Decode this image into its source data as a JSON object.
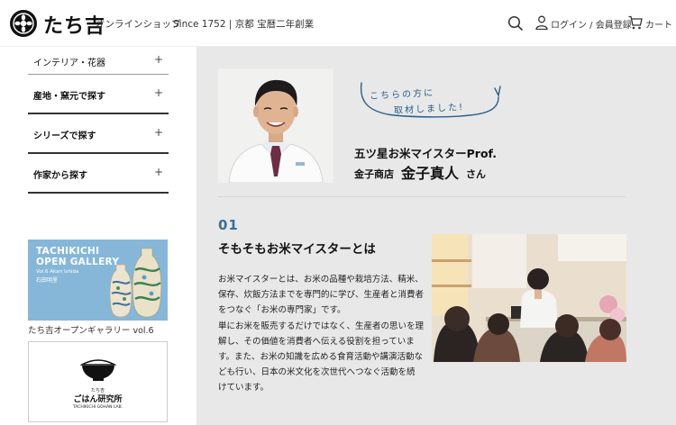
{
  "header": {
    "logo_text": "たち吉",
    "shop_label": "オンラインショップ",
    "since_label": "Since 1752 | 京都 宝暦二年創業",
    "login_label": "ログイン / 会員登録",
    "cart_label": "カート"
  },
  "sidebar": {
    "categories": [
      {
        "label": "インテリア・花器",
        "toggle": "+"
      },
      {
        "label": "産地・窯元で探す",
        "toggle": "+"
      },
      {
        "label": "シリーズで探す",
        "toggle": "+"
      },
      {
        "label": "作家から探す",
        "toggle": "+"
      }
    ],
    "gallery_banner": {
      "title_line1": "TACHIKICHI",
      "title_line2": "OPEN GALLERY",
      "vol": "Vol.6  Akari Ishida",
      "artist": "石田明里",
      "caption": "たち吉オープンギャラリー vol.6"
    },
    "gohan_banner": {
      "small": "たち吉",
      "title": "ごはん研究所",
      "en": "TACHIKICHI GOHAN LAB."
    }
  },
  "profile": {
    "bubble_line1": "こちらの方に",
    "bubble_line2": "取材しました!",
    "title": "五ツ星お米マイスターProf.",
    "shop": "金子商店",
    "name": "金子真人",
    "honorific": "さん"
  },
  "section": {
    "number": "01",
    "title": "そもそもお米マイスターとは",
    "paragraph_lines": [
      "お米マイスターとは、お米の品種や栽培方法、精米、",
      "保存、炊飯方法までを専門的に学び、生産者と消費者",
      "をつなぐ「お米の専門家」です。",
      "単にお米を販売するだけではなく、生産者の思いを理",
      "解し、その価値を消費者へ伝える役割を担っていま",
      "す。また、お米の知識を広める食育活動や講演活動な",
      "ども行い、日本の米文化を次世代へつなぐ活動を続",
      "けています。"
    ]
  },
  "colors": {
    "panel_bg": "#e8e8e8",
    "accent_blue": "#3a6f98",
    "banner_blue": "#86b7d8"
  }
}
